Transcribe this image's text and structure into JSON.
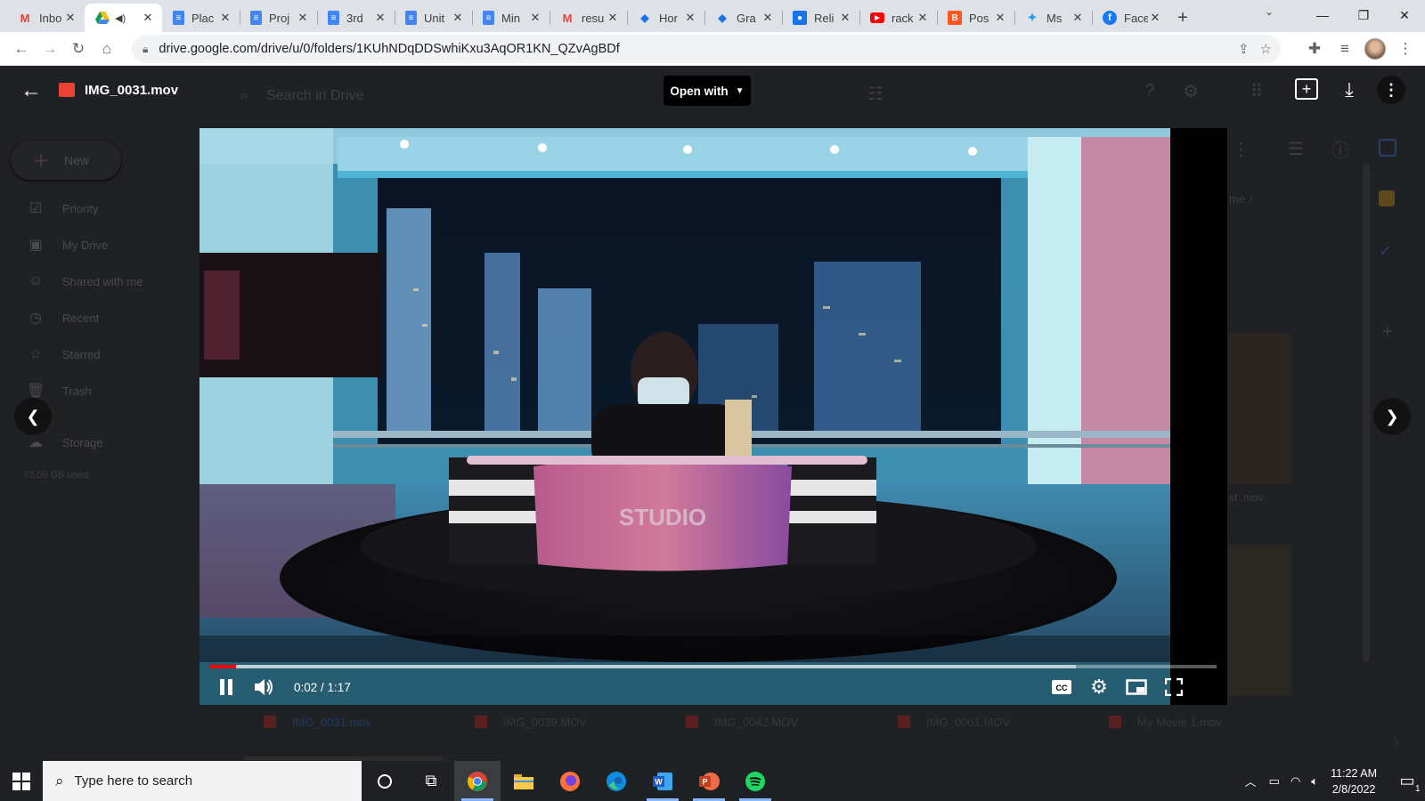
{
  "browser": {
    "tabs": [
      {
        "icon": "gmail-icon",
        "title": "Inbo"
      },
      {
        "icon": "google-drive-icon",
        "title": "",
        "active": true,
        "audio": true
      },
      {
        "icon": "google-docs-icon",
        "title": "Plac"
      },
      {
        "icon": "google-docs-icon",
        "title": "Proj"
      },
      {
        "icon": "google-docs-icon",
        "title": "3rd"
      },
      {
        "icon": "google-docs-icon",
        "title": "Unit"
      },
      {
        "icon": "google-docs-icon",
        "title": "Min"
      },
      {
        "icon": "gmail-icon",
        "title": "resu"
      },
      {
        "icon": "graduation-cap-icon",
        "title": "Hor"
      },
      {
        "icon": "graduation-cap-icon",
        "title": "Gra"
      },
      {
        "icon": "person-icon",
        "title": "Reli"
      },
      {
        "icon": "youtube-icon",
        "title": "rack"
      },
      {
        "icon": "blogger-icon",
        "title": "Pos"
      },
      {
        "icon": "twitter-icon",
        "title": "Ms"
      },
      {
        "icon": "facebook-icon",
        "title": "Face"
      }
    ],
    "url": "drive.google.com/drive/u/0/folders/1KUhNDqDDSwhiKxu3AqOR1KN_QZvAgBDf"
  },
  "drive_bg": {
    "search_placeholder": "Search in Drive",
    "new_label": "New",
    "sidebar": [
      {
        "icon": "check-circle-icon",
        "label": "Priority"
      },
      {
        "icon": "drive-icon",
        "label": "My Drive"
      },
      {
        "icon": "people-icon",
        "label": "Shared with me"
      },
      {
        "icon": "clock-icon",
        "label": "Recent"
      },
      {
        "icon": "star-icon",
        "label": "Starred"
      },
      {
        "icon": "trash-icon",
        "label": "Trash"
      },
      {
        "icon": "cloud-icon",
        "label": "Storage"
      }
    ],
    "storage_used": "72.09 GB used",
    "files": [
      "IMG_0031.mov",
      "IMG_0039.MOV",
      "IMG_0042.MOV",
      "IMG_0061.MOV",
      "My Movie 1.mov"
    ],
    "sort_label": "me",
    "partial_file": "st .mov"
  },
  "viewer": {
    "file_name": "IMG_0031.mov",
    "open_with_label": "Open with",
    "video": {
      "current_time": "0:02",
      "duration": "1:17",
      "time_display": "0:02 / 1:17",
      "progress_fraction": 0.026,
      "buffered_fraction": 0.86,
      "desk_text": "STUDIO"
    }
  },
  "taskbar": {
    "search_placeholder": "Type here to search",
    "apps": [
      "cortana-icon",
      "task-view-icon",
      "chrome-icon",
      "file-explorer-icon",
      "firefox-icon",
      "edge-icon",
      "word-icon",
      "powerpoint-icon",
      "spotify-icon"
    ],
    "time": "11:22 AM",
    "date": "2/8/2022",
    "notification_count": "1"
  },
  "colors": {
    "progress_red": "#ff0000",
    "drive_bg": "#202124",
    "tab_strip": "#dee1e6"
  }
}
